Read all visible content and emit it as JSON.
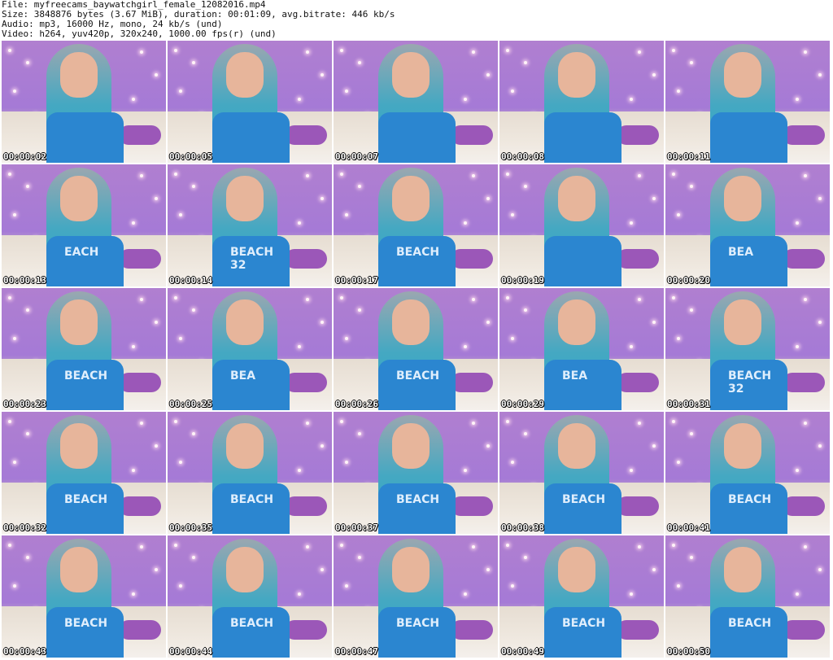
{
  "header": {
    "file": "File: myfreecams_baywatchgirl_female_12082016.mp4",
    "size": "Size: 3848876 bytes (3.67 MiB), duration: 00:01:09, avg.bitrate: 446 kb/s",
    "audio": "Audio: mp3, 16000 Hz, mono, 24 kb/s (und)",
    "video": "Video: h264, yuv420p, 320x240, 1000.00 fps(r) (und)"
  },
  "thumbnails": [
    {
      "timestamp": "00:00:02",
      "shirt_text": ""
    },
    {
      "timestamp": "00:00:05",
      "shirt_text": ""
    },
    {
      "timestamp": "00:00:07",
      "shirt_text": ""
    },
    {
      "timestamp": "00:00:08",
      "shirt_text": ""
    },
    {
      "timestamp": "00:00:11",
      "shirt_text": ""
    },
    {
      "timestamp": "00:00:13",
      "shirt_text": "EACH"
    },
    {
      "timestamp": "00:00:14",
      "shirt_text": "BEACH 32"
    },
    {
      "timestamp": "00:00:17",
      "shirt_text": "BEACH"
    },
    {
      "timestamp": "00:00:19",
      "shirt_text": ""
    },
    {
      "timestamp": "00:00:20",
      "shirt_text": "BEA"
    },
    {
      "timestamp": "00:00:23",
      "shirt_text": "BEACH"
    },
    {
      "timestamp": "00:00:25",
      "shirt_text": "BEA"
    },
    {
      "timestamp": "00:00:26",
      "shirt_text": "BEACH"
    },
    {
      "timestamp": "00:00:29",
      "shirt_text": "BEA"
    },
    {
      "timestamp": "00:00:31",
      "shirt_text": "BEACH 32"
    },
    {
      "timestamp": "00:00:32",
      "shirt_text": "BEACH"
    },
    {
      "timestamp": "00:00:35",
      "shirt_text": "BEACH"
    },
    {
      "timestamp": "00:00:37",
      "shirt_text": "BEACH"
    },
    {
      "timestamp": "00:00:38",
      "shirt_text": "BEACH"
    },
    {
      "timestamp": "00:00:41",
      "shirt_text": "BEACH"
    },
    {
      "timestamp": "00:00:43",
      "shirt_text": "BEACH"
    },
    {
      "timestamp": "00:00:44",
      "shirt_text": "BEACH"
    },
    {
      "timestamp": "00:00:47",
      "shirt_text": "BEACH"
    },
    {
      "timestamp": "00:00:49",
      "shirt_text": "BEACH"
    },
    {
      "timestamp": "00:00:50",
      "shirt_text": "BEACH"
    }
  ],
  "colors": {
    "background": "#ffffff",
    "wall": "#a57ad6",
    "shirt": "#2b86d0",
    "hair": "#45a8c2"
  }
}
